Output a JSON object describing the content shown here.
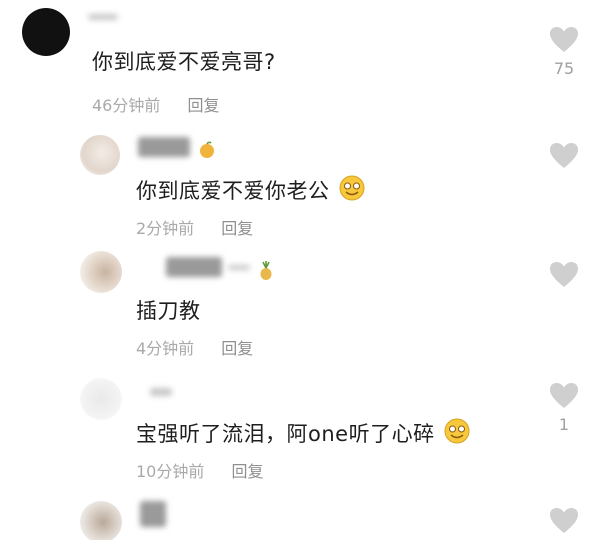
{
  "comments": [
    {
      "text": "你到底爱不爱亮哥?",
      "time": "46分钟前",
      "reply": "回复",
      "likes": "75"
    },
    {
      "text": "你到底爱不爱你老公",
      "time": "2分钟前",
      "reply": "回复",
      "likes": ""
    },
    {
      "text": "插刀教",
      "time": "4分钟前",
      "reply": "回复",
      "likes": ""
    },
    {
      "text": "宝强听了流泪，阿one听了心碎",
      "time": "10分钟前",
      "reply": "回复",
      "likes": "1"
    },
    {
      "text": "",
      "time": "",
      "reply": "",
      "likes": ""
    }
  ],
  "icons": {
    "like": "heart-icon",
    "emoji": "smiling-face-icon"
  },
  "colors": {
    "heart": "#cfcfcf",
    "meta_text": "#a9a9a9"
  }
}
